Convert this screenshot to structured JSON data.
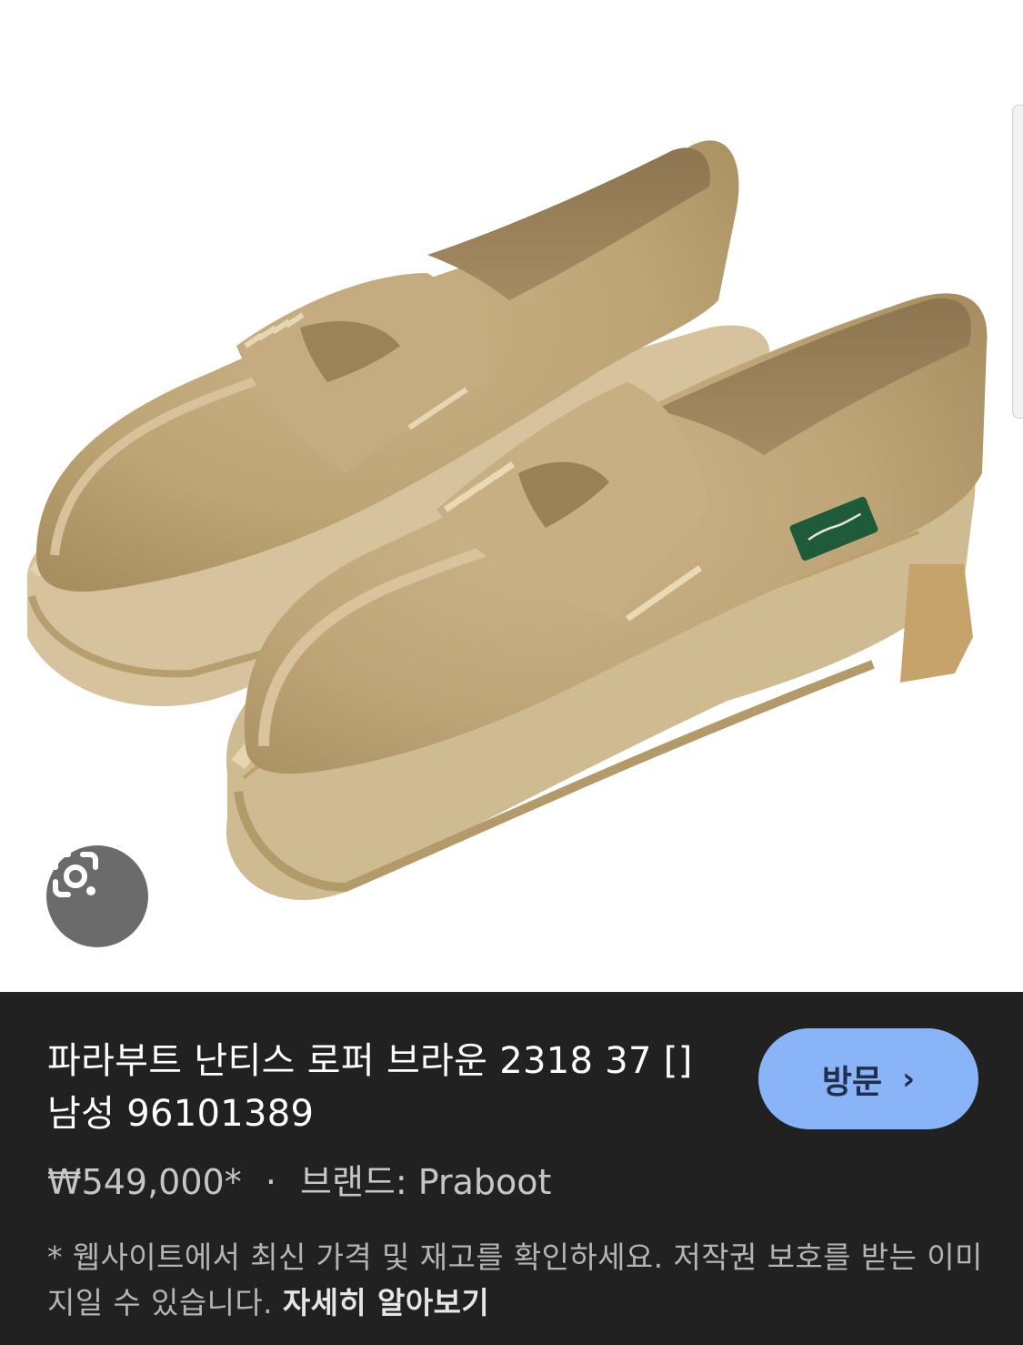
{
  "product": {
    "title": "파라부트 난티스 로퍼 브라운 2318 37 [] 남성 96101389",
    "price": "₩549,000*",
    "separator": "·",
    "brand": "브랜드: Praboot"
  },
  "actions": {
    "visit_label": "방문",
    "visit_chevron": "›",
    "lens_icon": "google-lens-icon"
  },
  "disclaimer": {
    "text": "* 웹사이트에서 최신 가격 및 재고를 확인하세요. 저작권 보호를 받는 이미지일 수 있습니다. ",
    "more_label": "자세히 알아보기"
  },
  "colors": {
    "panel_bg": "#212121",
    "accent_button": "#8ab4f8",
    "suede": "#c3aa7e",
    "sole": "#d8c49d",
    "tag": "#1f5b3a"
  }
}
